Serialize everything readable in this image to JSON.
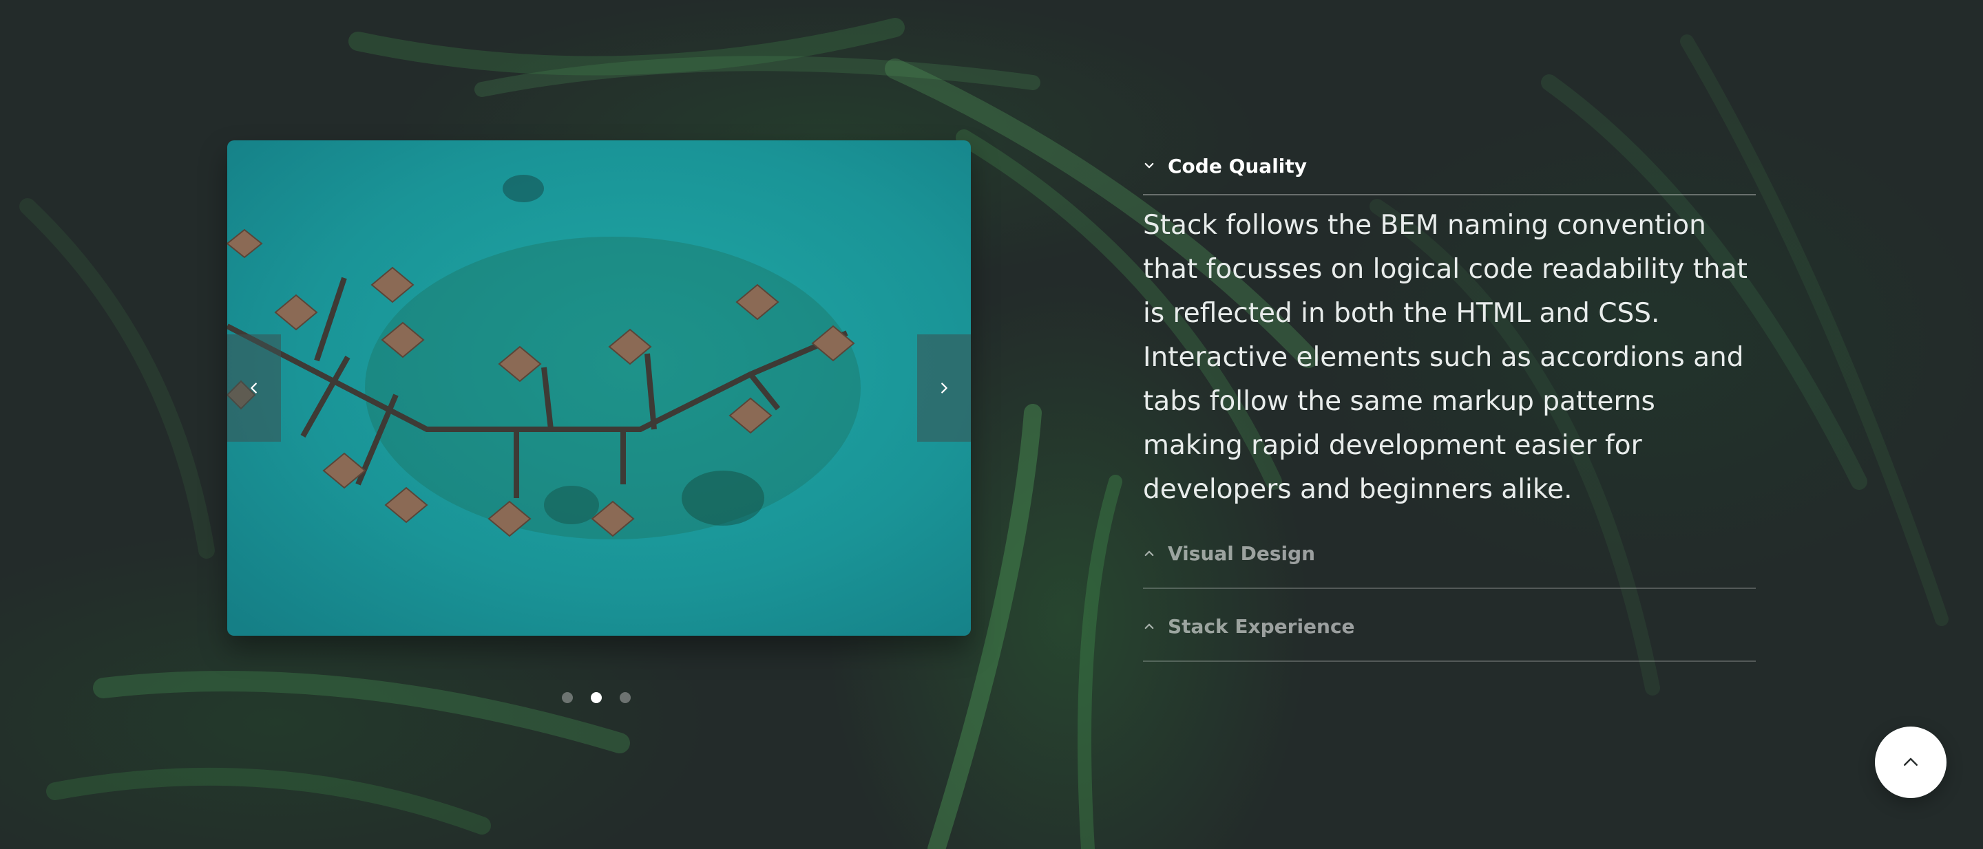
{
  "slider": {
    "prev_icon": "chevron-left-icon",
    "next_icon": "chevron-right-icon",
    "dots": [
      {
        "active": false
      },
      {
        "active": true
      },
      {
        "active": false
      }
    ]
  },
  "accordion": {
    "items": [
      {
        "title": "Code Quality",
        "open": true,
        "content": "Stack follows the BEM naming convention that focusses on logical code readability that is reflected in both the HTML and CSS. Interactive elements such as accordions and tabs follow the same markup patterns making rapid development easier for developers and beginners alike."
      },
      {
        "title": "Visual Design",
        "open": false
      },
      {
        "title": "Stack Experience",
        "open": false
      }
    ]
  },
  "back_to_top": {
    "icon": "chevron-up-icon"
  },
  "colors": {
    "background": "#232b2a",
    "water": "#1a9a9a",
    "text": "#ffffff"
  }
}
